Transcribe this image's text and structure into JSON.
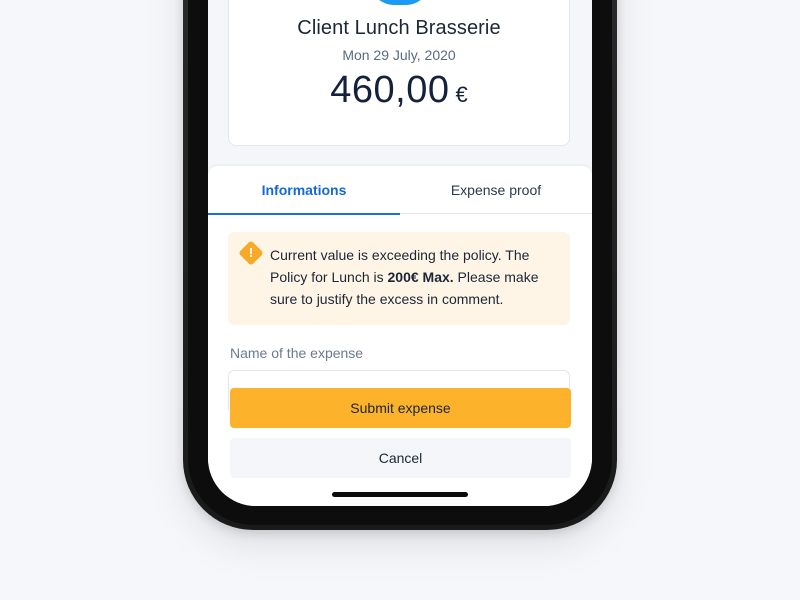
{
  "summary": {
    "title": "Client Lunch Brasserie",
    "date": "Mon 29 July, 2020",
    "amount": "460,00",
    "currency": "€",
    "category_icon": "fork-knife-icon",
    "category_color": "#1a9cf4"
  },
  "tabs": [
    {
      "label": "Informations",
      "active": true
    },
    {
      "label": "Expense proof",
      "active": false
    }
  ],
  "alert": {
    "icon": "warning-icon",
    "text_before": "Current value is exceeding the policy. The Policy for Lunch is ",
    "highlight": "200€ Max.",
    "text_after": " Please make sure to justify the excess in comment.",
    "background": "#fff5e6",
    "icon_color": "#f7a928"
  },
  "form": {
    "name_label": "Name of the expense"
  },
  "actions": {
    "submit_label": "Submit expense",
    "cancel_label": "Cancel",
    "submit_color": "#fdb22b",
    "accent_color": "#1469d6"
  }
}
